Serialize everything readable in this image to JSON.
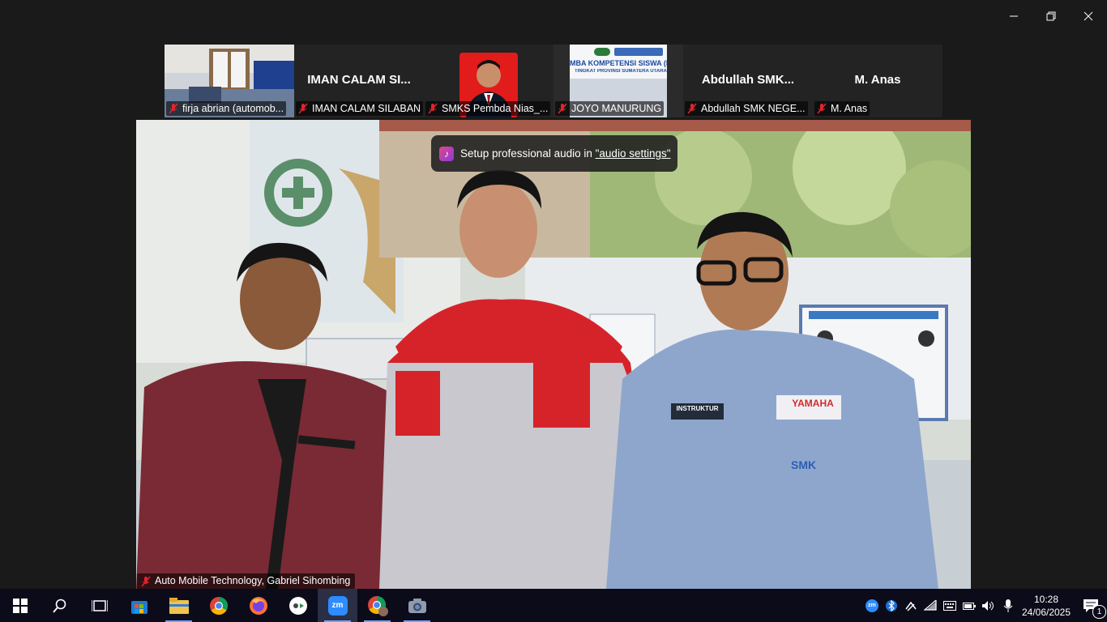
{
  "window": {
    "controls": {
      "minimize": "minimize-icon",
      "restore": "restore-icon",
      "close": "close-icon"
    }
  },
  "gallery": [
    {
      "display_name": "",
      "label": "firja abrian (automob...",
      "kind": "video"
    },
    {
      "display_name": "IMAN CALAM SI...",
      "label": "IMAN CALAM SILABAN",
      "kind": "name"
    },
    {
      "display_name": "",
      "label": "SMKS Pembda Nias_...",
      "kind": "photo"
    },
    {
      "display_name": "",
      "label": "JOYO MANURUNG",
      "kind": "poster",
      "poster_line1": "MBA KOMPETENSI SISWA (LK",
      "poster_line2": "TINGKAT PROVINSI SUMATERA UTARA TAHUN"
    },
    {
      "display_name": "Abdullah SMK...",
      "label": "Abdullah SMK NEGE...",
      "kind": "name"
    },
    {
      "display_name": "M. Anas",
      "label": "M. Anas",
      "kind": "name"
    }
  ],
  "toast": {
    "prefix": "Setup professional audio in ",
    "link": "\"audio settings\""
  },
  "speaker": {
    "label": "Auto Mobile Technology, Gabriel Sihombing",
    "shirt_left": "YAMAHA",
    "badge": "INSTRUKTUR",
    "logo": "SMK"
  },
  "taskbar": {
    "apps": [
      "windows-start-icon",
      "search-icon",
      "task-view-icon",
      "store-icon",
      "file-explorer-icon",
      "chrome-icon",
      "firefox-icon",
      "app-icon",
      "zoom-icon",
      "chrome-profile-icon",
      "camera-icon"
    ],
    "zoom_label": "zm",
    "tray_zoom_label": "zm",
    "time": "10:28",
    "date": "24/06/2025",
    "notifications": "1"
  },
  "colors": {
    "accent": "#6aa5ff",
    "mute_red": "#e0242c",
    "taskbar": "#0b0b1a"
  }
}
